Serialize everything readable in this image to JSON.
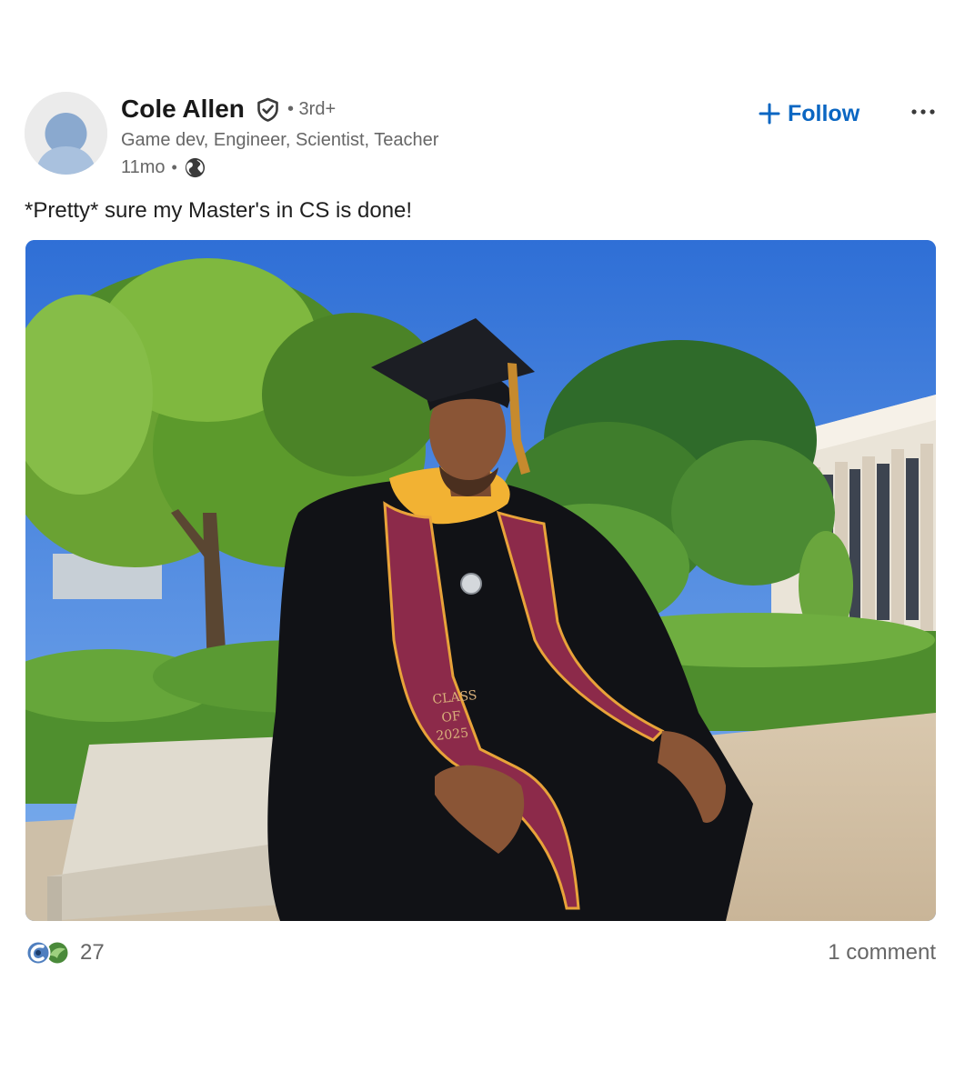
{
  "post": {
    "author": {
      "name": "Cole Allen",
      "connection_degree": "• 3rd+",
      "headline": "Game dev, Engineer, Scientist,  Teacher"
    },
    "meta": {
      "time": "11mo",
      "separator": "•",
      "visibility_icon": "globe-icon"
    },
    "actions": {
      "follow_label": "Follow",
      "more_icon": "ellipsis-icon"
    },
    "text": "*Pretty* sure my Master's in CS is done!",
    "photo": {
      "stole_text": [
        "CLASS",
        "OF",
        "2025"
      ]
    },
    "social": {
      "reaction_icons": [
        "celebrate-icon",
        "insightful-icon"
      ],
      "reaction_count": "27",
      "comments_label": "1 comment"
    }
  },
  "colors": {
    "accent": "#0a66c2",
    "muted_text": "#666666",
    "stole": "#8c2a4a",
    "hood_gold": "#f2b233"
  }
}
